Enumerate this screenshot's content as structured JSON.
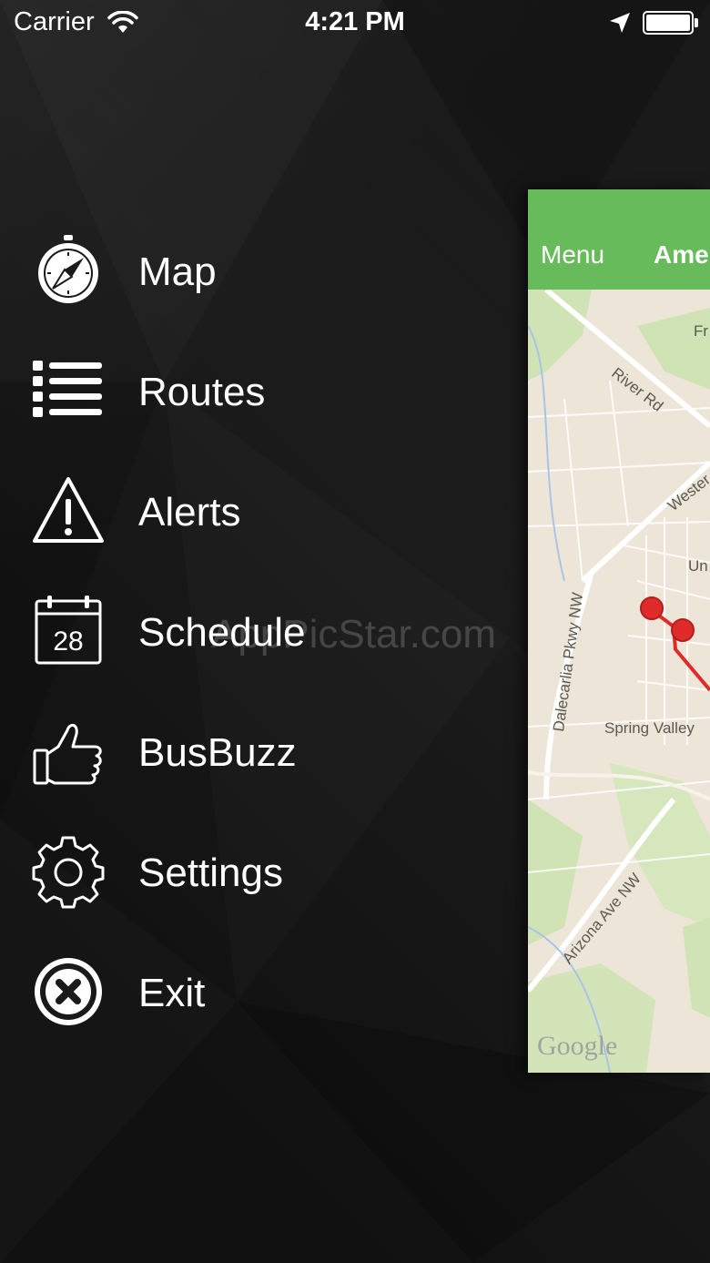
{
  "status_bar": {
    "carrier": "Carrier",
    "time": "4:21 PM"
  },
  "menu": {
    "items": [
      {
        "label": "Map",
        "icon": "compass-icon"
      },
      {
        "label": "Routes",
        "icon": "list-icon"
      },
      {
        "label": "Alerts",
        "icon": "warning-icon"
      },
      {
        "label": "Schedule",
        "icon": "calendar-icon",
        "calendar_day": "28"
      },
      {
        "label": "BusBuzz",
        "icon": "thumbs-up-icon"
      },
      {
        "label": "Settings",
        "icon": "gear-icon"
      },
      {
        "label": "Exit",
        "icon": "close-circle-icon"
      }
    ]
  },
  "watermark": "AppPicStar.com",
  "panel": {
    "nav_menu": "Menu",
    "nav_title": "Ame",
    "accent_color": "#67bb5a",
    "map": {
      "labels": {
        "river_rd": "River Rd",
        "fr": "Fr",
        "western": "Wester",
        "un": "Un",
        "dalecarlia": "Dalecarlia Pkwy NW",
        "spring_valley": "Spring Valley",
        "arizona": "Arizona Ave NW"
      },
      "provider": "Google",
      "route_color": "#e02b2b"
    }
  }
}
